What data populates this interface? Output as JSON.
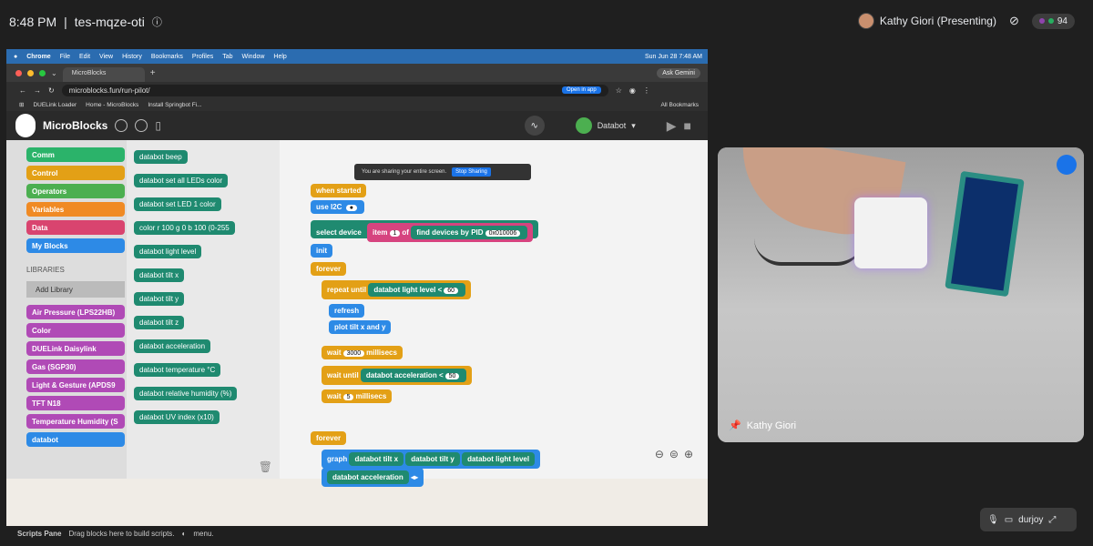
{
  "meet": {
    "time": "8:48 PM",
    "meeting_code": "tes-mqze-oti",
    "presenter": "Kathy Giori (Presenting)",
    "participants_count": "94",
    "tile_name": "Kathy Giori",
    "self_name": "durjoy"
  },
  "mac": {
    "menu": [
      "Chrome",
      "File",
      "Edit",
      "View",
      "History",
      "Bookmarks",
      "Profiles",
      "Tab",
      "Window",
      "Help"
    ],
    "clock": "Sun Jun 28 7:48 AM"
  },
  "browser": {
    "tab": "MicroBlocks",
    "ask": "Ask Gemini",
    "url": "microblocks.fun/run-pilot/",
    "open_in_app": "Open in app",
    "bookmarks": [
      "DUELink Loader",
      "Home - MicroBlocks",
      "Install Springbot Fi...",
      "All Bookmarks"
    ]
  },
  "microblocks": {
    "title": "MicroBlocks",
    "board": "Databot",
    "categories": [
      {
        "label": "Comm",
        "color": "#2bb36a"
      },
      {
        "label": "Control",
        "color": "#e3a016"
      },
      {
        "label": "Operators",
        "color": "#4caf50"
      },
      {
        "label": "Variables",
        "color": "#f08a24"
      },
      {
        "label": "Data",
        "color": "#d9446f"
      },
      {
        "label": "My Blocks",
        "color": "#2d8ae6"
      }
    ],
    "libraries_heading": "LIBRARIES",
    "add_library": "Add Library",
    "libraries": [
      {
        "label": "Air Pressure (LPS22HB)",
        "color": "#b04ab6"
      },
      {
        "label": "Color",
        "color": "#b04ab6"
      },
      {
        "label": "DUELink Daisylink",
        "color": "#b04ab6"
      },
      {
        "label": "Gas (SGP30)",
        "color": "#b04ab6"
      },
      {
        "label": "Light & Gesture (APDS9",
        "color": "#b04ab6"
      },
      {
        "label": "TFT N18",
        "color": "#b04ab6"
      },
      {
        "label": "Temperature Humidity (S",
        "color": "#b04ab6"
      },
      {
        "label": "databot",
        "color": "#2d8ae6"
      }
    ],
    "palette": [
      "databot beep",
      "databot set all LEDs color",
      "databot set LED 1 color",
      "color r 100 g 0 b 100 (0-255",
      "databot light level",
      "databot tilt x",
      "databot tilt y",
      "databot tilt z",
      "databot acceleration",
      "databot temperature °C",
      "databot relative humidity (%)",
      "databot UV index (x10)"
    ],
    "share_text": "You are sharing your entire screen.",
    "stop_sharing": "Stop Sharing",
    "script": {
      "when_started": "when started",
      "use_i2c": "use I2C",
      "select_device": "select device",
      "item": "item",
      "item_val": "1",
      "of": "of",
      "find_devices": "find devices by PID",
      "pid": "0x010006",
      "init": "init",
      "forever": "forever",
      "repeat_until": "repeat until",
      "light_level": "databot light level",
      "lt": "<",
      "light_thresh": "60",
      "refresh": "refresh",
      "plot": "plot tilt x and y",
      "wait": "wait",
      "wait_val": "3000",
      "millisecs": "millisecs",
      "wait_until": "wait until",
      "acceleration": "databot acceleration",
      "accel_thresh": "50",
      "wait_val2": "5",
      "forever2": "forever",
      "graph": "graph",
      "tilt_x": "databot tilt x",
      "tilt_y": "databot tilt y",
      "light_level2": "databot light level",
      "acceleration2": "databot acceleration"
    },
    "scripts_pane": "Scripts Pane",
    "scripts_hint": "Drag blocks here to build scripts.",
    "menu_hint": "menu."
  }
}
